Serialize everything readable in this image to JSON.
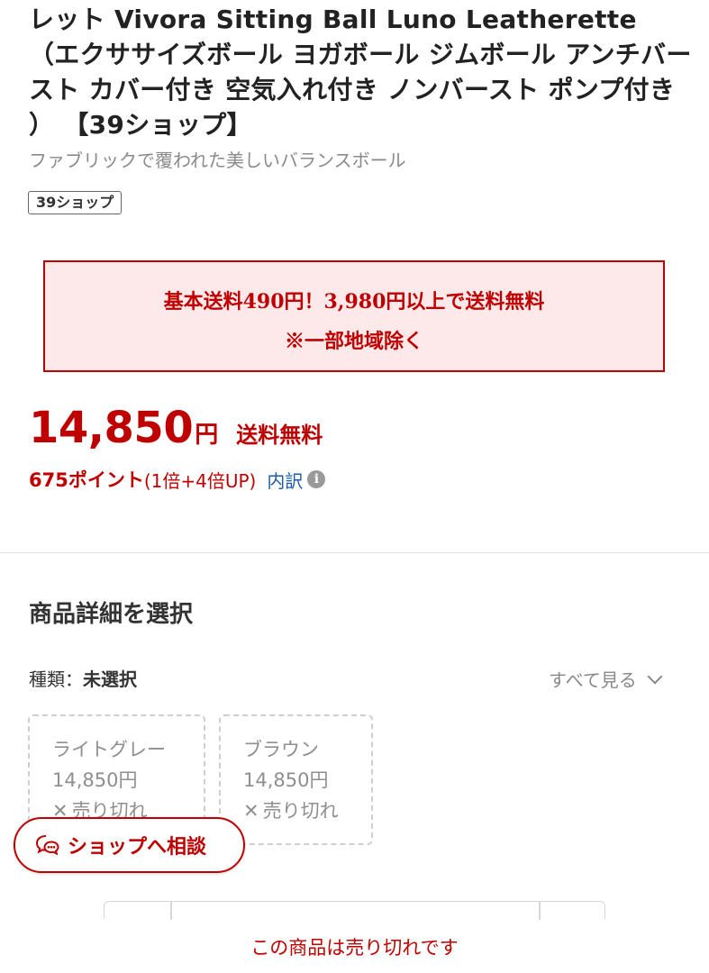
{
  "product": {
    "title": "レット Vivora Sitting Ball Luno Leatherette （エクササイズボール ヨガボール ジムボール アンチバースト カバー付き 空気入れ付き ノンバースト ポンプ付き ） 【39ショップ】",
    "subtitle": "ファブリックで覆われた美しいバランスボール",
    "shop_badge": "39ショップ"
  },
  "notice": {
    "line1": "基本送料490円！3,980円以上で送料無料",
    "line2": "※一部地域除く"
  },
  "price": {
    "amount": "14,850",
    "currency": "円",
    "shipping": "送料無料"
  },
  "points": {
    "main": "675ポイント",
    "detail": "(1倍+4倍UP)",
    "breakdown_link": "内訳",
    "info_icon": "i"
  },
  "options": {
    "section_title": "商品詳細を選択",
    "type_label": "種類：",
    "type_value": "未選択",
    "see_all": "すべて見る",
    "variants": [
      {
        "name": "ライトグレー",
        "price": "14,850円",
        "status": "売り切れ"
      },
      {
        "name": "ブラウン",
        "price": "14,850円",
        "status": "売り切れ"
      }
    ]
  },
  "consult_button": {
    "label": "ショップへ相談"
  },
  "sold_out_message": "この商品は売り切れです",
  "colors": {
    "accent": "#bf0000",
    "notice_bg": "#fde9e9",
    "link": "#1d5ca8"
  }
}
